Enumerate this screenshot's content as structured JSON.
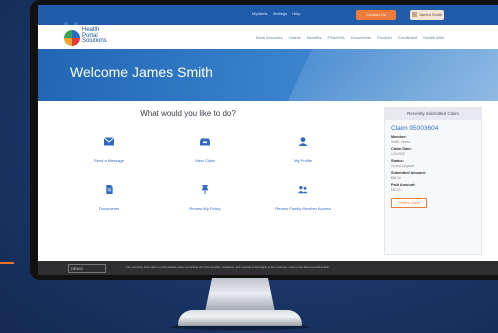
{
  "utility_bar": {
    "links": [
      "MyAlerts",
      "Settings",
      "Help"
    ],
    "help_button": "Contact Us",
    "user_button": "James Smith"
  },
  "brand": {
    "name_line1": "Health",
    "name_line2": "Portal",
    "name_line3": "Solutions",
    "tagline": "..."
  },
  "nav": {
    "items": [
      "Bank Accounts",
      "Claims",
      "Benefits",
      "FSA/HSA",
      "Documents",
      "Provider",
      "Enrollment",
      "Health eBill"
    ]
  },
  "hero": {
    "title": "Welcome James Smith"
  },
  "main": {
    "question": "What would you like to do?",
    "actions": [
      {
        "label": "Send a Message",
        "icon": "envelope-icon"
      },
      {
        "label": "View Claim",
        "icon": "inbox-icon"
      },
      {
        "label": "My Profile",
        "icon": "user-icon"
      },
      {
        "label": "Documents",
        "icon": "document-icon"
      },
      {
        "label": "Review My Policy",
        "icon": "pin-icon"
      },
      {
        "label": "Review Family Member Access",
        "icon": "family-icon"
      }
    ]
  },
  "claim_panel": {
    "title": "Recently Submitted Claim",
    "claim_number": "Claim 95003604",
    "fields": [
      {
        "label": "Member:",
        "value": "Smith, James"
      },
      {
        "label": "Claim Date:",
        "value": "1/19/2020"
      },
      {
        "label": "Status:",
        "value": "Closed-Upgrade"
      },
      {
        "label": "Submitted Amount:",
        "value": "$86.00"
      },
      {
        "label": "Paid Amount:",
        "value": "$50.00"
      }
    ],
    "button": "Review Claim"
  },
  "footer": {
    "badge": "DEMO",
    "note": "The summary information on this website does not include all of the benefits, limitations, and exclusions that apply to the coverage. Learn more about benefit details."
  },
  "colors": {
    "primary": "#1f5ba8",
    "accent": "#f07c3c",
    "link": "#2f6ac0",
    "footer": "#2e2e33"
  }
}
